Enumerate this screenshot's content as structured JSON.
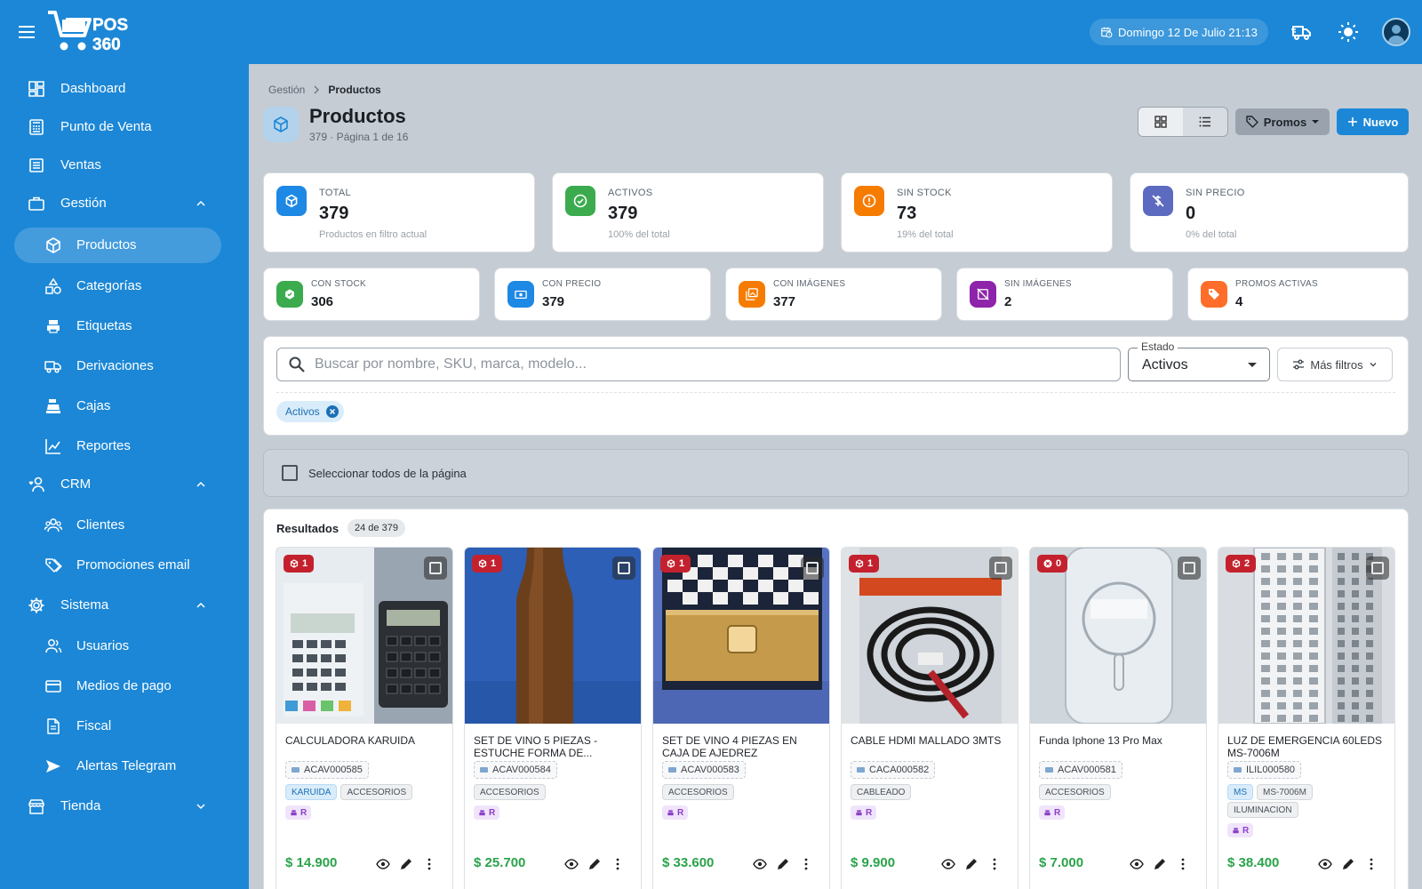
{
  "topbar": {
    "logo_text_top": "POS",
    "logo_text_bottom": "360",
    "datetime": "Domingo 12 De Julio 21:13"
  },
  "colors": {
    "primary": "#1c87d6",
    "green": "#3bab4e",
    "orange": "#f57c00",
    "indigo": "#5c6bc0",
    "purple": "#8e24aa",
    "blue": "#1e88e5",
    "red_badge": "#c4212e",
    "price_green": "#2aa34a"
  },
  "sidebar": {
    "items": [
      {
        "label": "Dashboard",
        "icon": "dashboard-icon"
      },
      {
        "label": "Punto de Venta",
        "icon": "register-icon"
      },
      {
        "label": "Ventas",
        "icon": "receipt-icon"
      },
      {
        "label": "Gestión",
        "icon": "briefcase-icon",
        "expanded": true
      },
      {
        "label": "Productos",
        "icon": "box-icon",
        "active": true
      },
      {
        "label": "Categorías",
        "icon": "shapes-icon"
      },
      {
        "label": "Etiquetas",
        "icon": "printer-icon"
      },
      {
        "label": "Derivaciones",
        "icon": "truck-icon"
      },
      {
        "label": "Cajas",
        "icon": "cash-register-icon"
      },
      {
        "label": "Reportes",
        "icon": "chart-line-icon"
      },
      {
        "label": "CRM",
        "icon": "user-heart-icon",
        "expanded": true
      },
      {
        "label": "Clientes",
        "icon": "users-icon"
      },
      {
        "label": "Promociones email",
        "icon": "tags-icon"
      },
      {
        "label": "Sistema",
        "icon": "gear-icon",
        "expanded": true
      },
      {
        "label": "Usuarios",
        "icon": "users-icon"
      },
      {
        "label": "Medios de pago",
        "icon": "credit-card-icon"
      },
      {
        "label": "Fiscal",
        "icon": "document-icon"
      },
      {
        "label": "Alertas Telegram",
        "icon": "send-icon"
      },
      {
        "label": "Tienda",
        "icon": "store-icon",
        "expanded": false
      }
    ]
  },
  "page": {
    "breadcrumb_root": "Gestión",
    "breadcrumb_current": "Productos",
    "title": "Productos",
    "subtitle": "379 · Página 1 de 16",
    "promos_label": "Promos",
    "nuevo_label": "Nuevo"
  },
  "stats_top": [
    {
      "label": "TOTAL",
      "value": "379",
      "desc": "Productos en filtro actual",
      "color": "#1e88e5"
    },
    {
      "label": "ACTIVOS",
      "value": "379",
      "desc": "100% del total",
      "color": "#3bab4e"
    },
    {
      "label": "SIN STOCK",
      "value": "73",
      "desc": "19% del total",
      "color": "#f57c00"
    },
    {
      "label": "SIN PRECIO",
      "value": "0",
      "desc": "0% del total",
      "color": "#5c6bc0"
    }
  ],
  "stats_bottom": [
    {
      "label": "CON STOCK",
      "value": "306",
      "color": "#3bab4e"
    },
    {
      "label": "CON PRECIO",
      "value": "379",
      "color": "#1e88e5"
    },
    {
      "label": "CON IMÁGENES",
      "value": "377",
      "color": "#f57c00"
    },
    {
      "label": "SIN IMÁGENES",
      "value": "2",
      "color": "#8e24aa"
    },
    {
      "label": "PROMOS ACTIVAS",
      "value": "4",
      "color": "#ff6d2a"
    }
  ],
  "filters": {
    "search_placeholder": "Buscar por nombre, SKU, marca, modelo...",
    "search_value": "",
    "estado_label": "Estado",
    "estado_value": "Activos",
    "mas_filtros": "Más filtros",
    "active_chip": "Activos"
  },
  "select_all_label": "Seleccionar todos de la página",
  "results": {
    "title": "Resultados",
    "count": "24 de 379"
  },
  "products": [
    {
      "stock": "1",
      "name": "CALCULADORA KARUIDA",
      "sku": "ACAV000585",
      "tags": [
        {
          "t": "KARUIDA",
          "blue": true
        },
        {
          "t": "ACCESORIOS"
        }
      ],
      "rtag": "R",
      "price": "$ 14.900",
      "img": "calculator"
    },
    {
      "stock": "1",
      "name": "SET DE VINO 5 PIEZAS - ESTUCHE FORMA DE...",
      "sku": "ACAV000584",
      "tags": [
        {
          "t": "ACCESORIOS"
        }
      ],
      "rtag": "R",
      "price": "$ 25.700",
      "img": "wine"
    },
    {
      "stock": "1",
      "name": "SET DE VINO 4 PIEZAS EN CAJA DE AJEDREZ",
      "sku": "ACAV000583",
      "tags": [
        {
          "t": "ACCESORIOS"
        }
      ],
      "rtag": "R",
      "price": "$ 33.600",
      "img": "chess"
    },
    {
      "stock": "1",
      "name": "CABLE HDMI MALLADO 3MTS",
      "sku": "CACA000582",
      "tags": [
        {
          "t": "CABLEADO"
        }
      ],
      "rtag": "R",
      "price": "$ 9.900",
      "img": "cable"
    },
    {
      "stock": "0",
      "name": "Funda Iphone 13 Pro Max",
      "sku": "ACAV000581",
      "tags": [
        {
          "t": "ACCESORIOS"
        }
      ],
      "rtag": "R",
      "price": "$ 7.000",
      "img": "case"
    },
    {
      "stock": "2",
      "name": "LUZ DE EMERGENCIA 60LEDS MS-7006M",
      "sku": "ILIL000580",
      "tags": [
        {
          "t": "MS",
          "blue": true
        },
        {
          "t": "MS-7006M"
        }
      ],
      "tags2": [
        {
          "t": "ILUMINACION"
        }
      ],
      "rtag": "R",
      "price": "$ 38.400",
      "img": "light"
    }
  ]
}
